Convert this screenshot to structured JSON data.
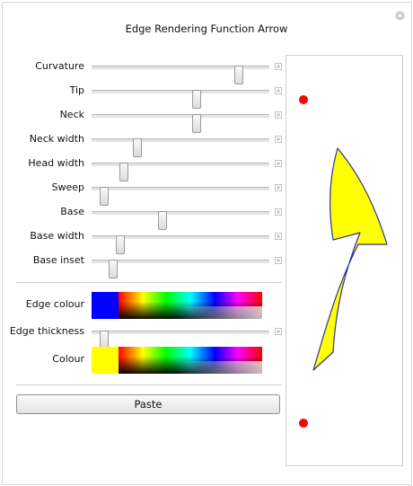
{
  "window": {
    "title": "Edge Rendering Function Arrow",
    "close_icon": "close-icon"
  },
  "sliders": [
    {
      "label": "Curvature",
      "value": 0.83
    },
    {
      "label": "Tip",
      "value": 0.59
    },
    {
      "label": "Neck",
      "value": 0.59
    },
    {
      "label": "Neck width",
      "value": 0.26
    },
    {
      "label": "Head width",
      "value": 0.18
    },
    {
      "label": "Sweep",
      "value": 0.07
    },
    {
      "label": "Base",
      "value": 0.4
    },
    {
      "label": "Base width",
      "value": 0.16
    },
    {
      "label": "Base inset",
      "value": 0.12
    }
  ],
  "edge_colour": {
    "label": "Edge colour",
    "value": "#0000ff"
  },
  "edge_thickness": {
    "label": "Edge thickness",
    "value": 0.07
  },
  "colour": {
    "label": "Colour",
    "value": "#ffff00"
  },
  "paste_button": {
    "label": "Paste"
  },
  "preview": {
    "arrow_fill": "#ffff00",
    "arrow_stroke": "#3030a0",
    "endpoint_color": "#ff0000"
  }
}
